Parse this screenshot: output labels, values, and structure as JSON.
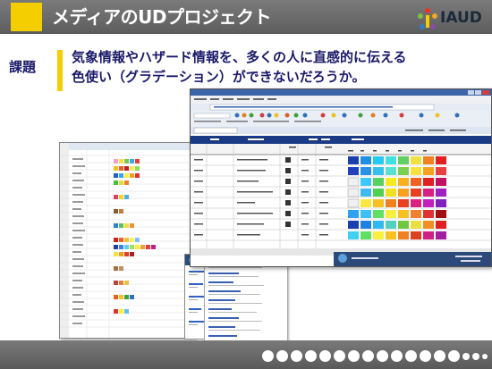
{
  "header": {
    "title": "メディアのUDプロジェクト",
    "logo_text": "IAUD"
  },
  "content": {
    "tag": "課題",
    "subtitle_line1": "気象情報やハザード情報を、多くの人に直感的に伝える",
    "subtitle_line2": "色使い（グラデーション）ができないだろうか。"
  },
  "colors": {
    "header": "#666666",
    "accent": "#f5ce00",
    "text": "#1a1a6a",
    "table_header": "#1a3a86"
  },
  "icons": {
    "logo": "iaud-logo-icon"
  }
}
